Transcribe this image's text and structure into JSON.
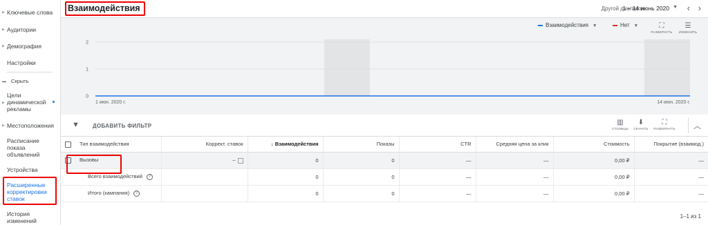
{
  "sidebar": {
    "items": [
      {
        "label": "Ключевые слова",
        "has_arrow": true
      },
      {
        "label": "Аудитории",
        "has_arrow": true
      },
      {
        "label": "Демография",
        "has_arrow": true
      },
      {
        "label": "Настройки",
        "has_arrow": false
      }
    ],
    "hide_label": "Скрыть",
    "items2": [
      {
        "label": "Цели динамической рекламы",
        "has_arrow": true,
        "has_dot": true
      },
      {
        "label": "Местоположения",
        "has_arrow": true
      },
      {
        "label": "Расписание показа объявлений",
        "has_arrow": false
      },
      {
        "label": "Устройства",
        "has_arrow": false
      },
      {
        "label": "Расширенные корректировки ставок",
        "active": true
      },
      {
        "label": "История изменений",
        "has_arrow": false
      }
    ]
  },
  "header": {
    "title": "Взаимодействия",
    "range_label": "Другой диапазон",
    "range_value": "1 – 14 июнь 2020",
    "prev_icon": "chevron-left-icon",
    "next_icon": "chevron-right-icon"
  },
  "chart_controls": {
    "metric1": "Взаимодействия",
    "metric1_color": "#1a73e8",
    "metric2": "Нет",
    "metric2_color": "#d93025",
    "expand_label": "РАЗВЕРНУТЬ",
    "edit_label": "ИЗМЕНИТЬ"
  },
  "chart_data": {
    "type": "line",
    "x_start": "1 июн. 2020 г.",
    "x_end": "14 июн. 2020 г.",
    "yticks": [
      "2",
      "1",
      "0"
    ],
    "ylim": [
      0,
      2
    ],
    "series": [
      {
        "values": [
          0,
          0,
          0,
          0,
          0,
          0,
          0,
          0,
          0,
          0,
          0,
          0,
          0,
          0
        ],
        "color": "#1a73e8"
      }
    ],
    "weekend_bands": [
      [
        6,
        7
      ],
      [
        13,
        14
      ]
    ]
  },
  "filterbar": {
    "add_filter": "ДОБАВИТЬ ФИЛЬТР",
    "columns_label": "СТОЛБЦЫ",
    "download_label": "СКАЧАТЬ",
    "expand_label": "РАЗВЕРНУТЬ"
  },
  "table": {
    "headers": [
      "Тип взаимодействия",
      "Коррект. ставок",
      "Взаимодействия",
      "Показы",
      "CTR",
      "Средняя цена за клик",
      "Стоимость",
      "Покрытие (взаимод.)"
    ],
    "sort_arrow": "↓",
    "rows": [
      {
        "type": "Вызовы",
        "bid": "–",
        "interactions": "0",
        "impressions": "0",
        "ctr": "—",
        "cpc": "—",
        "cost": "0,00 ₽",
        "coverage": "—"
      },
      {
        "type": "Всего взаимодействий",
        "bid": "",
        "interactions": "0",
        "impressions": "0",
        "ctr": "—",
        "cpc": "—",
        "cost": "0,00 ₽",
        "coverage": "—"
      },
      {
        "type": "Итого (кампания)",
        "bid": "",
        "interactions": "0",
        "impressions": "0",
        "ctr": "—",
        "cpc": "—",
        "cost": "0,00 ₽",
        "coverage": "—"
      }
    ],
    "pager": "1–1 из 1"
  }
}
